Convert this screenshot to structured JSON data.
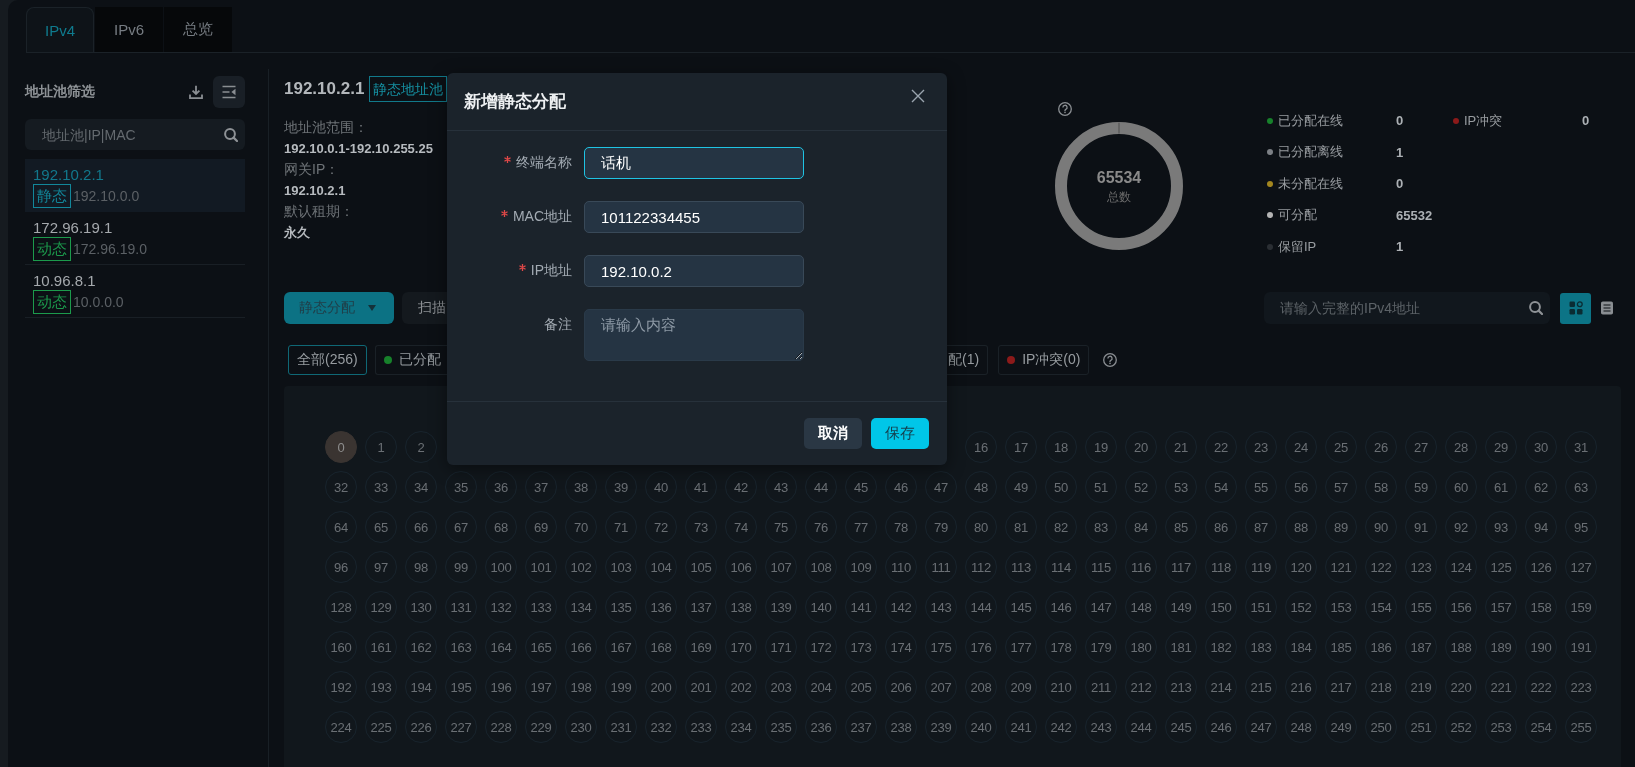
{
  "tabs": [
    {
      "label": "IPv4",
      "selected": true
    },
    {
      "label": "IPv6",
      "selected": false
    },
    {
      "label": "总览",
      "selected": false
    }
  ],
  "sidebar": {
    "title": "地址池筛选",
    "search": {
      "placeholder": "地址池|IP|MAC"
    },
    "pools": [
      {
        "name": "192.10.2.1",
        "tag": {
          "label": "静态",
          "color": "#12879a"
        },
        "subnet": "192.10.0.0",
        "selected": true
      },
      {
        "name": "172.96.19.1",
        "tag": {
          "label": "动态",
          "color": "#1c9a4c"
        },
        "subnet": "172.96.19.0",
        "selected": false
      },
      {
        "name": "10.96.8.1",
        "tag": {
          "label": "动态",
          "color": "#1c9a4c"
        },
        "subnet": "10.0.0.0",
        "selected": false
      }
    ]
  },
  "pool_detail": {
    "name": "192.10.2.1",
    "tag": "静态地址池",
    "fields": [
      {
        "label": "地址池范围：",
        "value": "192.10.0.1-192.10.255.25"
      },
      {
        "label": "网关IP：",
        "value": "192.10.2.1"
      },
      {
        "label": "默认租期：",
        "value": "永久"
      }
    ]
  },
  "summary": {
    "total": "65534",
    "total_label": "总数",
    "legend": [
      {
        "items": [
          {
            "label": "已分配在线",
            "value": "0",
            "color": "#17812b"
          },
          {
            "label": "已分配离线",
            "value": "1",
            "color": "#7c8085"
          },
          {
            "label": "未分配在线",
            "value": "0",
            "color": "#a3861f"
          },
          {
            "label": "可分配",
            "value": "65532",
            "color": "#b4b4b4"
          },
          {
            "label": "保留IP",
            "value": "1",
            "color": "#2a2e33"
          }
        ]
      },
      {
        "items": [
          {
            "label": "IP冲突",
            "value": "0",
            "color": "#8c1a1a"
          }
        ]
      }
    ]
  },
  "toolbar": {
    "assign_button": "静态分配",
    "scan_button": "扫描",
    "search": {
      "placeholder": "请输入完整的IPv4地址"
    },
    "views": [
      {
        "kind": "grid",
        "selected": true
      },
      {
        "kind": "list",
        "selected": false
      }
    ]
  },
  "filters": {
    "before_dialog": [
      {
        "label": "全部(256)",
        "selected": true
      },
      {
        "label": "已分配",
        "selected": false,
        "color": "#17812b"
      }
    ],
    "after_dialog": [
      {
        "label": "配(1)",
        "selected": false
      },
      {
        "label": "IP冲突(0)",
        "selected": false,
        "color": "#8c1a1a"
      }
    ]
  },
  "ip_grid": {
    "rows": [
      {
        "cells": [
          {
            "label": "0",
            "selected": true
          },
          {
            "label": "1",
            "selected": false
          },
          {
            "label": "2",
            "selected": false
          }
        ],
        "cells_after_dialog": [
          {
            "label": "16",
            "selected": false
          },
          {
            "label": "17",
            "selected": false
          },
          {
            "label": "18",
            "selected": false
          },
          {
            "label": "19",
            "selected": false
          },
          {
            "label": "20",
            "selected": false
          },
          {
            "label": "21",
            "selected": false
          },
          {
            "label": "22",
            "selected": false
          },
          {
            "label": "23",
            "selected": false
          },
          {
            "label": "24",
            "selected": false
          },
          {
            "label": "25",
            "selected": false
          },
          {
            "label": "26",
            "selected": false
          },
          {
            "label": "27",
            "selected": false
          },
          {
            "label": "28",
            "selected": false
          },
          {
            "label": "29",
            "selected": false
          },
          {
            "label": "30",
            "selected": false
          },
          {
            "label": "31",
            "selected": false
          }
        ]
      },
      {
        "cells": [
          {
            "label": "32",
            "selected": false
          },
          {
            "label": "33",
            "selected": false
          },
          {
            "label": "34",
            "selected": false
          },
          {
            "label": "35",
            "selected": false
          },
          {
            "label": "36",
            "selected": false
          },
          {
            "label": "37",
            "selected": false
          },
          {
            "label": "38",
            "selected": false
          },
          {
            "label": "39",
            "selected": false
          },
          {
            "label": "40",
            "selected": false
          },
          {
            "label": "41",
            "selected": false
          },
          {
            "label": "42",
            "selected": false
          },
          {
            "label": "43",
            "selected": false
          },
          {
            "label": "44",
            "selected": false
          },
          {
            "label": "45",
            "selected": false
          },
          {
            "label": "46",
            "selected": false
          },
          {
            "label": "47",
            "selected": false
          },
          {
            "label": "48",
            "selected": false
          },
          {
            "label": "49",
            "selected": false
          },
          {
            "label": "50",
            "selected": false
          },
          {
            "label": "51",
            "selected": false
          },
          {
            "label": "52",
            "selected": false
          },
          {
            "label": "53",
            "selected": false
          },
          {
            "label": "54",
            "selected": false
          },
          {
            "label": "55",
            "selected": false
          },
          {
            "label": "56",
            "selected": false
          },
          {
            "label": "57",
            "selected": false
          },
          {
            "label": "58",
            "selected": false
          },
          {
            "label": "59",
            "selected": false
          },
          {
            "label": "60",
            "selected": false
          },
          {
            "label": "61",
            "selected": false
          },
          {
            "label": "62",
            "selected": false
          },
          {
            "label": "63",
            "selected": false
          }
        ]
      },
      {
        "cells": [
          {
            "label": "64",
            "selected": false
          },
          {
            "label": "65",
            "selected": false
          },
          {
            "label": "66",
            "selected": false
          },
          {
            "label": "67",
            "selected": false
          },
          {
            "label": "68",
            "selected": false
          },
          {
            "label": "69",
            "selected": false
          },
          {
            "label": "70",
            "selected": false
          },
          {
            "label": "71",
            "selected": false
          },
          {
            "label": "72",
            "selected": false
          },
          {
            "label": "73",
            "selected": false
          },
          {
            "label": "74",
            "selected": false
          },
          {
            "label": "75",
            "selected": false
          },
          {
            "label": "76",
            "selected": false
          },
          {
            "label": "77",
            "selected": false
          },
          {
            "label": "78",
            "selected": false
          },
          {
            "label": "79",
            "selected": false
          },
          {
            "label": "80",
            "selected": false
          },
          {
            "label": "81",
            "selected": false
          },
          {
            "label": "82",
            "selected": false
          },
          {
            "label": "83",
            "selected": false
          },
          {
            "label": "84",
            "selected": false
          },
          {
            "label": "85",
            "selected": false
          },
          {
            "label": "86",
            "selected": false
          },
          {
            "label": "87",
            "selected": false
          },
          {
            "label": "88",
            "selected": false
          },
          {
            "label": "89",
            "selected": false
          },
          {
            "label": "90",
            "selected": false
          },
          {
            "label": "91",
            "selected": false
          },
          {
            "label": "92",
            "selected": false
          },
          {
            "label": "93",
            "selected": false
          },
          {
            "label": "94",
            "selected": false
          },
          {
            "label": "95",
            "selected": false
          }
        ]
      },
      {
        "cells": [
          {
            "label": "96",
            "selected": false
          },
          {
            "label": "97",
            "selected": false
          },
          {
            "label": "98",
            "selected": false
          },
          {
            "label": "99",
            "selected": false
          },
          {
            "label": "100",
            "selected": false
          },
          {
            "label": "101",
            "selected": false
          },
          {
            "label": "102",
            "selected": false
          },
          {
            "label": "103",
            "selected": false
          },
          {
            "label": "104",
            "selected": false
          },
          {
            "label": "105",
            "selected": false
          },
          {
            "label": "106",
            "selected": false
          },
          {
            "label": "107",
            "selected": false
          },
          {
            "label": "108",
            "selected": false
          },
          {
            "label": "109",
            "selected": false
          },
          {
            "label": "110",
            "selected": false
          },
          {
            "label": "111",
            "selected": false
          },
          {
            "label": "112",
            "selected": false
          },
          {
            "label": "113",
            "selected": false
          },
          {
            "label": "114",
            "selected": false
          },
          {
            "label": "115",
            "selected": false
          },
          {
            "label": "116",
            "selected": false
          },
          {
            "label": "117",
            "selected": false
          },
          {
            "label": "118",
            "selected": false
          },
          {
            "label": "119",
            "selected": false
          },
          {
            "label": "120",
            "selected": false
          },
          {
            "label": "121",
            "selected": false
          },
          {
            "label": "122",
            "selected": false
          },
          {
            "label": "123",
            "selected": false
          },
          {
            "label": "124",
            "selected": false
          },
          {
            "label": "125",
            "selected": false
          },
          {
            "label": "126",
            "selected": false
          },
          {
            "label": "127",
            "selected": false
          }
        ]
      },
      {
        "cells": [
          {
            "label": "128",
            "selected": false
          },
          {
            "label": "129",
            "selected": false
          },
          {
            "label": "130",
            "selected": false
          },
          {
            "label": "131",
            "selected": false
          },
          {
            "label": "132",
            "selected": false
          },
          {
            "label": "133",
            "selected": false
          },
          {
            "label": "134",
            "selected": false
          },
          {
            "label": "135",
            "selected": false
          },
          {
            "label": "136",
            "selected": false
          },
          {
            "label": "137",
            "selected": false
          },
          {
            "label": "138",
            "selected": false
          },
          {
            "label": "139",
            "selected": false
          },
          {
            "label": "140",
            "selected": false
          },
          {
            "label": "141",
            "selected": false
          },
          {
            "label": "142",
            "selected": false
          },
          {
            "label": "143",
            "selected": false
          },
          {
            "label": "144",
            "selected": false
          },
          {
            "label": "145",
            "selected": false
          },
          {
            "label": "146",
            "selected": false
          },
          {
            "label": "147",
            "selected": false
          },
          {
            "label": "148",
            "selected": false
          },
          {
            "label": "149",
            "selected": false
          },
          {
            "label": "150",
            "selected": false
          },
          {
            "label": "151",
            "selected": false
          },
          {
            "label": "152",
            "selected": false
          },
          {
            "label": "153",
            "selected": false
          },
          {
            "label": "154",
            "selected": false
          },
          {
            "label": "155",
            "selected": false
          },
          {
            "label": "156",
            "selected": false
          },
          {
            "label": "157",
            "selected": false
          },
          {
            "label": "158",
            "selected": false
          },
          {
            "label": "159",
            "selected": false
          }
        ]
      },
      {
        "cells": [
          {
            "label": "160",
            "selected": false
          },
          {
            "label": "161",
            "selected": false
          },
          {
            "label": "162",
            "selected": false
          },
          {
            "label": "163",
            "selected": false
          },
          {
            "label": "164",
            "selected": false
          },
          {
            "label": "165",
            "selected": false
          },
          {
            "label": "166",
            "selected": false
          },
          {
            "label": "167",
            "selected": false
          },
          {
            "label": "168",
            "selected": false
          },
          {
            "label": "169",
            "selected": false
          },
          {
            "label": "170",
            "selected": false
          },
          {
            "label": "171",
            "selected": false
          },
          {
            "label": "172",
            "selected": false
          },
          {
            "label": "173",
            "selected": false
          },
          {
            "label": "174",
            "selected": false
          },
          {
            "label": "175",
            "selected": false
          },
          {
            "label": "176",
            "selected": false
          },
          {
            "label": "177",
            "selected": false
          },
          {
            "label": "178",
            "selected": false
          },
          {
            "label": "179",
            "selected": false
          },
          {
            "label": "180",
            "selected": false
          },
          {
            "label": "181",
            "selected": false
          },
          {
            "label": "182",
            "selected": false
          },
          {
            "label": "183",
            "selected": false
          },
          {
            "label": "184",
            "selected": false
          },
          {
            "label": "185",
            "selected": false
          },
          {
            "label": "186",
            "selected": false
          },
          {
            "label": "187",
            "selected": false
          },
          {
            "label": "188",
            "selected": false
          },
          {
            "label": "189",
            "selected": false
          },
          {
            "label": "190",
            "selected": false
          },
          {
            "label": "191",
            "selected": false
          }
        ]
      },
      {
        "cells": [
          {
            "label": "192",
            "selected": false
          },
          {
            "label": "193",
            "selected": false
          },
          {
            "label": "194",
            "selected": false
          },
          {
            "label": "195",
            "selected": false
          },
          {
            "label": "196",
            "selected": false
          },
          {
            "label": "197",
            "selected": false
          },
          {
            "label": "198",
            "selected": false
          },
          {
            "label": "199",
            "selected": false
          },
          {
            "label": "200",
            "selected": false
          },
          {
            "label": "201",
            "selected": false
          },
          {
            "label": "202",
            "selected": false
          },
          {
            "label": "203",
            "selected": false
          },
          {
            "label": "204",
            "selected": false
          },
          {
            "label": "205",
            "selected": false
          },
          {
            "label": "206",
            "selected": false
          },
          {
            "label": "207",
            "selected": false
          },
          {
            "label": "208",
            "selected": false
          },
          {
            "label": "209",
            "selected": false
          },
          {
            "label": "210",
            "selected": false
          },
          {
            "label": "211",
            "selected": false
          },
          {
            "label": "212",
            "selected": false
          },
          {
            "label": "213",
            "selected": false
          },
          {
            "label": "214",
            "selected": false
          },
          {
            "label": "215",
            "selected": false
          },
          {
            "label": "216",
            "selected": false
          },
          {
            "label": "217",
            "selected": false
          },
          {
            "label": "218",
            "selected": false
          },
          {
            "label": "219",
            "selected": false
          },
          {
            "label": "220",
            "selected": false
          },
          {
            "label": "221",
            "selected": false
          },
          {
            "label": "222",
            "selected": false
          },
          {
            "label": "223",
            "selected": false
          }
        ]
      },
      {
        "cells": [
          {
            "label": "224",
            "selected": false
          },
          {
            "label": "225",
            "selected": false
          },
          {
            "label": "226",
            "selected": false
          },
          {
            "label": "227",
            "selected": false
          },
          {
            "label": "228",
            "selected": false
          },
          {
            "label": "229",
            "selected": false
          },
          {
            "label": "230",
            "selected": false
          },
          {
            "label": "231",
            "selected": false
          },
          {
            "label": "232",
            "selected": false
          },
          {
            "label": "233",
            "selected": false
          },
          {
            "label": "234",
            "selected": false
          },
          {
            "label": "235",
            "selected": false
          },
          {
            "label": "236",
            "selected": false
          },
          {
            "label": "237",
            "selected": false
          },
          {
            "label": "238",
            "selected": false
          },
          {
            "label": "239",
            "selected": false
          },
          {
            "label": "240",
            "selected": false
          },
          {
            "label": "241",
            "selected": false
          },
          {
            "label": "242",
            "selected": false
          },
          {
            "label": "243",
            "selected": false
          },
          {
            "label": "244",
            "selected": false
          },
          {
            "label": "245",
            "selected": false
          },
          {
            "label": "246",
            "selected": false
          },
          {
            "label": "247",
            "selected": false
          },
          {
            "label": "248",
            "selected": false
          },
          {
            "label": "249",
            "selected": false
          },
          {
            "label": "250",
            "selected": false
          },
          {
            "label": "251",
            "selected": false
          },
          {
            "label": "252",
            "selected": false
          },
          {
            "label": "253",
            "selected": false
          },
          {
            "label": "254",
            "selected": false
          },
          {
            "label": "255",
            "selected": false
          }
        ]
      }
    ]
  },
  "dialog": {
    "title": "新增静态分配",
    "fields": [
      {
        "kind": "input",
        "label": "终端名称",
        "required": true,
        "value": "话机",
        "focused": true
      },
      {
        "kind": "input",
        "label": "MAC地址",
        "required": true,
        "value": "101122334455",
        "focused": false
      },
      {
        "kind": "input",
        "label": "IP地址",
        "required": true,
        "value": "192.10.0.2",
        "focused": false
      },
      {
        "kind": "textarea",
        "label": "备注",
        "required": false,
        "placeholder": "请输入内容",
        "focused": false
      }
    ],
    "buttons": [
      {
        "kind": "secondary",
        "label": "取消"
      },
      {
        "kind": "primary",
        "label": "保存"
      }
    ]
  }
}
